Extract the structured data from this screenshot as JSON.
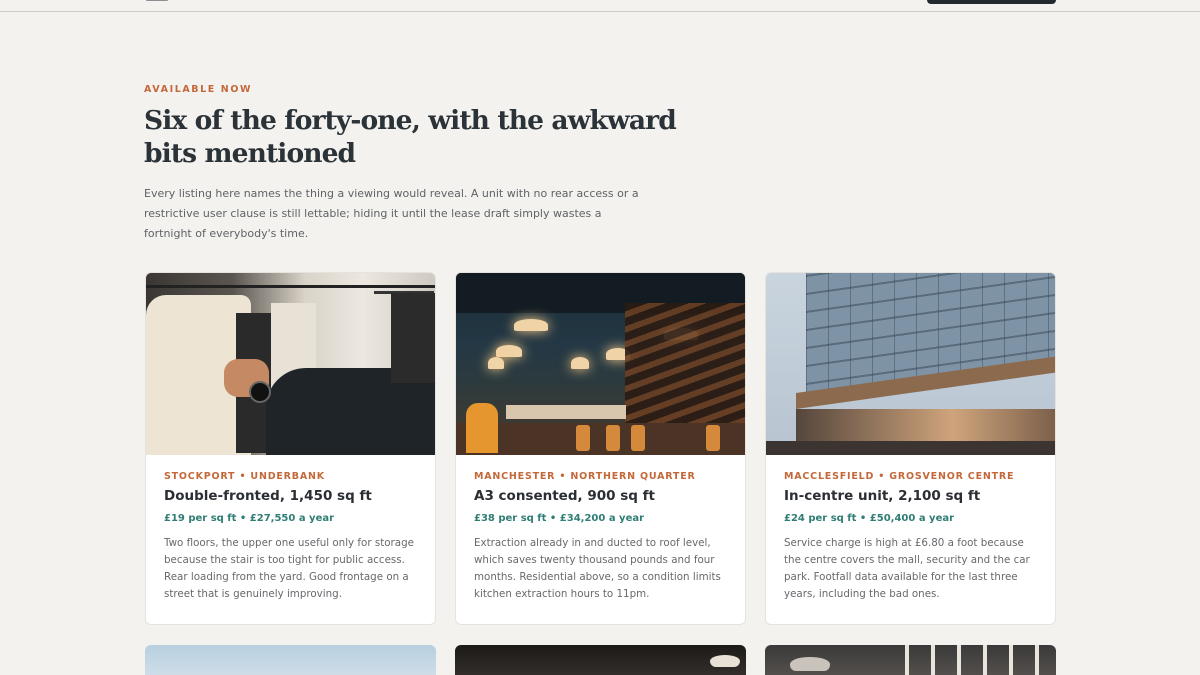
{
  "section": {
    "eyebrow": "AVAILABLE NOW",
    "headline": "Six of the forty-one, with the awkward bits mentioned",
    "intro": "Every listing here names the thing a viewing would reveal. A unit with no rear access or a restrictive user clause is still lettable; hiding it until the lease draft simply wastes a fortnight of everybody's time."
  },
  "listings": [
    {
      "location": "STOCKPORT • UNDERBANK",
      "title": "Double-fronted, 1,450 sq ft",
      "price": "£19 per sq ft • £27,550 a year",
      "description": "Two floors, the upper one useful only for storage because the stair is too tight for public access. Rear loading from the yard. Good frontage on a street that is genuinely improving.",
      "photo": "clothing-rail-photo"
    },
    {
      "location": "MANCHESTER • NORTHERN QUARTER",
      "title": "A3 consented, 900 sq ft",
      "price": "£38 per sq ft • £34,200 a year",
      "description": "Extraction already in and ducted to roof level, which saves twenty thousand pounds and four months. Residential above, so a condition limits kitchen extraction hours to 11pm.",
      "photo": "restaurant-interior-photo"
    },
    {
      "location": "MACCLESFIELD • GROSVENOR CENTRE",
      "title": "In-centre unit, 2,100 sq ft",
      "price": "£24 per sq ft • £50,400 a year",
      "description": "Service charge is high at £6.80 a foot because the centre covers the mall, security and the car park. Footfall data available for the last three years, including the bad ones.",
      "photo": "glass-building-photo"
    }
  ],
  "colors": {
    "accent": "#c4683a",
    "price": "#2f7d74",
    "background": "#f3f2ef",
    "headline": "#2b3338"
  }
}
